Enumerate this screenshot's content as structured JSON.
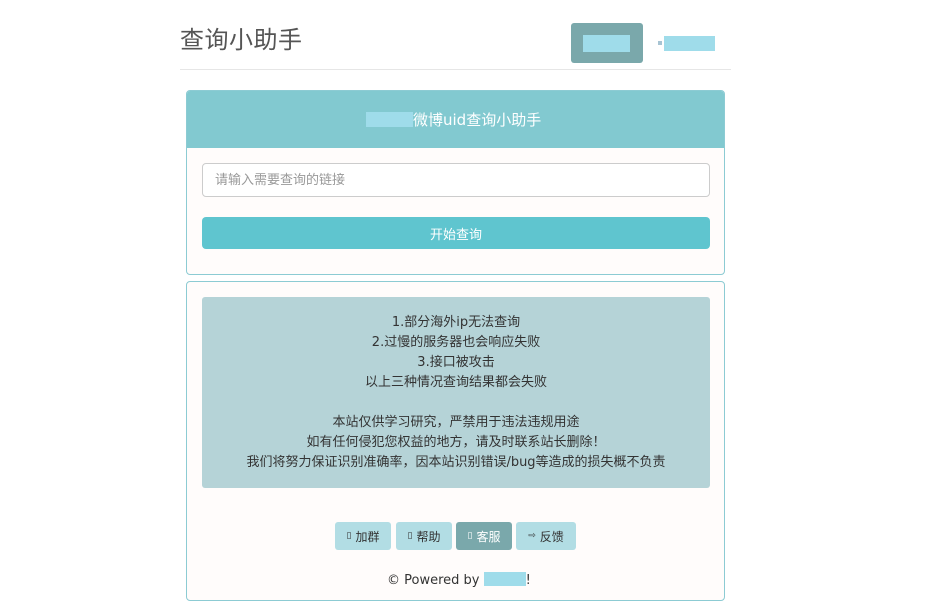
{
  "header": {
    "site_title": "查询小助手"
  },
  "query_panel": {
    "heading_text": "微博uid查询小助手",
    "input_value": "",
    "input_placeholder": "请输入需要查询的链接",
    "submit_label": "开始查询"
  },
  "notice": {
    "lines_group1": [
      "1.部分海外ip无法查询",
      "2.过慢的服务器也会响应失败",
      "3.接口被攻击",
      "以上三种情况查询结果都会失败"
    ],
    "lines_group2": [
      "本站仅供学习研究，严禁用于违法违规用途",
      "如有任何侵犯您权益的地方，请及时联系站长删除！",
      "我们将努力保证识别准确率，因本站识别错误/bug等造成的损失概不负责"
    ]
  },
  "buttons": [
    {
      "label": "加群",
      "icon": "group-icon",
      "glyph": "▯"
    },
    {
      "label": "帮助",
      "icon": "help-icon",
      "glyph": "▯"
    },
    {
      "label": "客服",
      "icon": "support-icon",
      "glyph": "▯"
    },
    {
      "label": "反馈",
      "icon": "feedback-icon",
      "glyph": "⇨"
    }
  ],
  "footer": {
    "prefix": "© Powered by ",
    "suffix": "!"
  },
  "colors": {
    "accent": "#5fc5cf",
    "heading_bg": "#82c9d0",
    "active_button": "#7aa8ab",
    "notice_bg": "#b5d3d7"
  }
}
